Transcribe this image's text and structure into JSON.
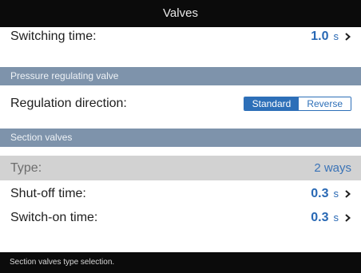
{
  "window": {
    "title": "Valves"
  },
  "rows": {
    "switching_time": {
      "label": "Switching time:",
      "value": "1.0",
      "unit": "s"
    },
    "regulation_direction": {
      "label": "Regulation direction:",
      "options": [
        "Standard",
        "Reverse"
      ],
      "selected": "Standard"
    },
    "type": {
      "label": "Type:",
      "value": "2 ways"
    },
    "shutoff_time": {
      "label": "Shut-off time:",
      "value": "0.3",
      "unit": "s"
    },
    "switchon_time": {
      "label": "Switch-on time:",
      "value": "0.3",
      "unit": "s"
    }
  },
  "sections": {
    "pressure_regulating_valve": "Pressure regulating valve",
    "section_valves": "Section valves"
  },
  "status": {
    "text": "Section valves type selection."
  },
  "icons": {
    "chevron": "chevron-right-icon"
  },
  "colors": {
    "titlebar": "#0b0b0b",
    "section_header": "#7e93ab",
    "accent": "#2868b4",
    "selected_row": "#d2d2d2"
  }
}
